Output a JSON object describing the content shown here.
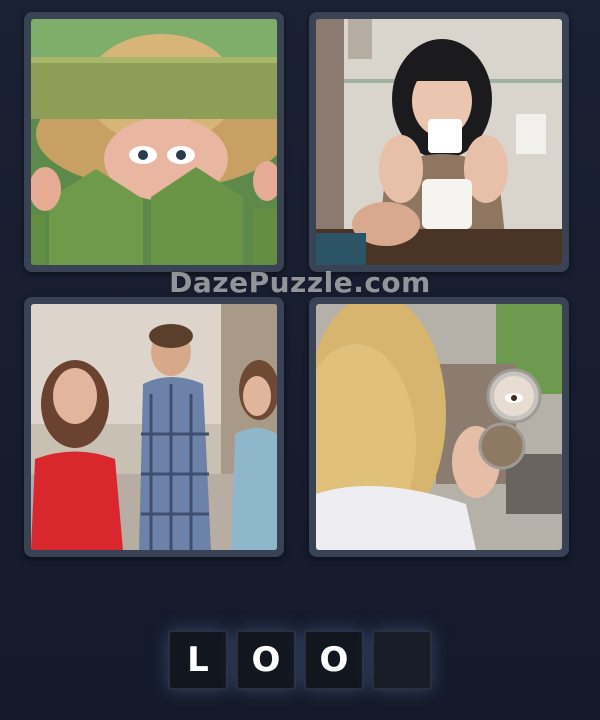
{
  "watermark": "DazePuzzle.com",
  "images": [
    {
      "name": "man-peeking-over-fence"
    },
    {
      "name": "woman-drinking-coffee"
    },
    {
      "name": "distracted-boyfriend"
    },
    {
      "name": "woman-with-compact-mirror"
    }
  ],
  "answer": {
    "letters": [
      "L",
      "O",
      "O",
      ""
    ]
  },
  "colors": {
    "background": "#161b2c",
    "frame": "#3a4256",
    "tile": "#12161f"
  }
}
